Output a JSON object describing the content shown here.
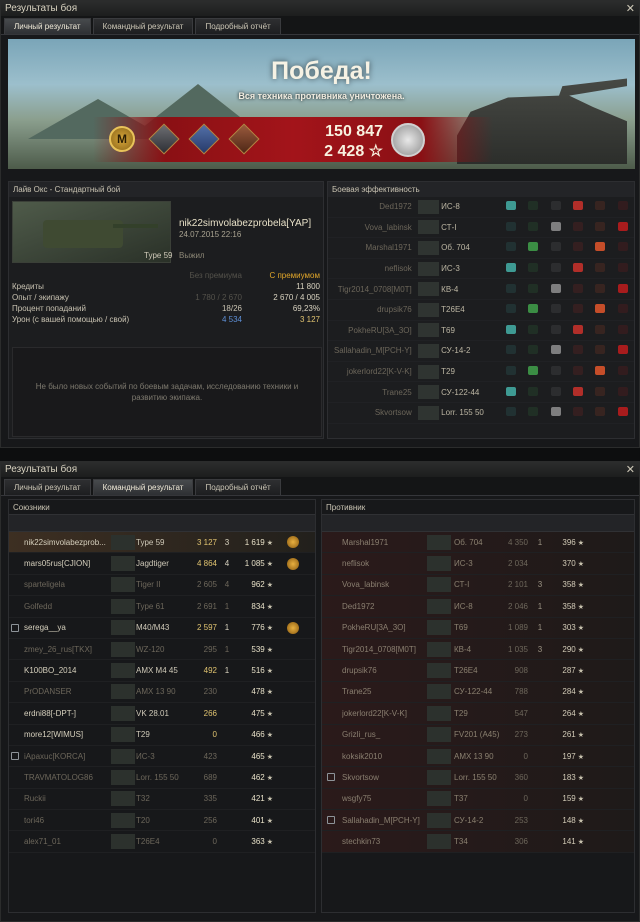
{
  "window_title": "Результаты боя",
  "close_glyph": "✕",
  "tabs": [
    "Личный результат",
    "Командный результат",
    "Подробный отчёт"
  ],
  "banner": {
    "title": "Победа!",
    "subtitle": "Вся техника противника уничтожена.",
    "credits": "150 847",
    "xp": "2 428 ☆",
    "mastery_badge": "М"
  },
  "personal": {
    "battle_type": "Лайв Окс - Стандартный бой",
    "player_name": "nik22simvolabezprobela[YAP]",
    "date": "24.07.2015 22:16",
    "tank": "Type 59",
    "status": "Выжил",
    "col_without": "Без премиума",
    "col_with": "С премиумом",
    "rows": [
      {
        "label": "Кредиты",
        "without": "",
        "with": "11 800"
      },
      {
        "label": "Опыт / экипажу",
        "without": "1 780 / 2 670",
        "with": "2 670 / 4 005"
      },
      {
        "label": "Процент попаданий",
        "without": "18/26",
        "with": "69,23%"
      },
      {
        "label": "Урон (с вашей помощью / свой)",
        "without": "4 534",
        "with": "3 127"
      }
    ],
    "no_events": "Не было новых событий по боевым задачам, исследованию техники и развитию экипажа."
  },
  "efficiency": {
    "header": "Боевая эффективность",
    "rows": [
      {
        "player": "Ded1972",
        "tank": "ИС-8"
      },
      {
        "player": "Vova_labinsk",
        "tank": "СТ-I"
      },
      {
        "player": "Marshal1971",
        "tank": "Об. 704"
      },
      {
        "player": "neflisok",
        "tank": "ИС-3"
      },
      {
        "player": "Tigr2014_0708[M0T]",
        "tank": "КВ-4"
      },
      {
        "player": "drupsik76",
        "tank": "T26E4"
      },
      {
        "player": "PokheRU[3A_3O]",
        "tank": "T69"
      },
      {
        "player": "Sallahadin_M[PCH-Y]",
        "tank": "СУ-14-2"
      },
      {
        "player": "jokerlord22[K-V-K]",
        "tank": "T29"
      },
      {
        "player": "Trane25",
        "tank": "СУ-122-44"
      },
      {
        "player": "Skvortsow",
        "tank": "Lorr. 155 50"
      }
    ]
  },
  "team": {
    "allies_label": "Союзники",
    "enemies_label": "Противник",
    "allies": [
      {
        "name": "nik22simvolabezprob...",
        "tank": "Type 59",
        "dmg": "3 127",
        "kills": "3",
        "xp": "1 619",
        "medal": true,
        "dead": false,
        "hl": true
      },
      {
        "name": "mars05rus[CJION]",
        "tank": "Jagdtiger",
        "dmg": "4 864",
        "kills": "4",
        "xp": "1 085",
        "medal": true,
        "dead": false
      },
      {
        "name": "sparteligela",
        "tank": "Tiger II",
        "dmg": "2 605",
        "kills": "4",
        "xp": "962",
        "dead": true
      },
      {
        "name": "Golfedd",
        "tank": "Type 61",
        "dmg": "2 691",
        "kills": "1",
        "xp": "834",
        "dead": true
      },
      {
        "name": "serega__ya",
        "tank": "M40/M43",
        "dmg": "2 597",
        "kills": "1",
        "xp": "776",
        "medal": true,
        "dead": false,
        "platoon": true
      },
      {
        "name": "zmey_26_rus[TKX]",
        "tank": "WZ-120",
        "dmg": "295",
        "kills": "1",
        "xp": "539",
        "dead": true
      },
      {
        "name": "K100BO_2014",
        "tank": "AMX M4 45",
        "dmg": "492",
        "kills": "1",
        "xp": "516",
        "dead": false
      },
      {
        "name": "PrODANSER",
        "tank": "AMX 13 90",
        "dmg": "230",
        "kills": "",
        "xp": "478",
        "dead": true
      },
      {
        "name": "erdni88[-DPT-]",
        "tank": "VK 28.01",
        "dmg": "266",
        "kills": "",
        "xp": "475",
        "dead": false
      },
      {
        "name": "more12[WIMUS]",
        "tank": "T29",
        "dmg": "0",
        "kills": "",
        "xp": "466",
        "dead": false
      },
      {
        "name": "iApaxuc[KORCA]",
        "tank": "ИС-3",
        "dmg": "423",
        "kills": "",
        "xp": "465",
        "dead": true,
        "platoon": true
      },
      {
        "name": "TRAVMATOLOG86",
        "tank": "Lorr. 155 50",
        "dmg": "689",
        "kills": "",
        "xp": "462",
        "dead": true
      },
      {
        "name": "Ruckii",
        "tank": "T32",
        "dmg": "335",
        "kills": "",
        "xp": "421",
        "dead": true
      },
      {
        "name": "tori46",
        "tank": "T20",
        "dmg": "256",
        "kills": "",
        "xp": "401",
        "dead": true
      },
      {
        "name": "alex71_01",
        "tank": "T26E4",
        "dmg": "0",
        "kills": "",
        "xp": "363",
        "dead": true
      }
    ],
    "enemies": [
      {
        "name": "Marshal1971",
        "tank": "Об. 704",
        "dmg": "4 350",
        "kills": "1",
        "xp": "396"
      },
      {
        "name": "neflisok",
        "tank": "ИС-3",
        "dmg": "2 034",
        "kills": "",
        "xp": "370"
      },
      {
        "name": "Vova_labinsk",
        "tank": "СТ-I",
        "dmg": "2 101",
        "kills": "3",
        "xp": "358"
      },
      {
        "name": "Ded1972",
        "tank": "ИС-8",
        "dmg": "2 046",
        "kills": "1",
        "xp": "358"
      },
      {
        "name": "PokheRU[3A_3O]",
        "tank": "T69",
        "dmg": "1 089",
        "kills": "1",
        "xp": "303"
      },
      {
        "name": "Tigr2014_0708[M0T]",
        "tank": "КВ-4",
        "dmg": "1 035",
        "kills": "3",
        "xp": "290"
      },
      {
        "name": "drupsik76",
        "tank": "T26E4",
        "dmg": "908",
        "kills": "",
        "xp": "287"
      },
      {
        "name": "Trane25",
        "tank": "СУ-122-44",
        "dmg": "788",
        "kills": "",
        "xp": "284"
      },
      {
        "name": "jokerlord22[K-V-K]",
        "tank": "T29",
        "dmg": "547",
        "kills": "",
        "xp": "264"
      },
      {
        "name": "Grizli_rus_",
        "tank": "FV201 (A45)",
        "dmg": "273",
        "kills": "",
        "xp": "261"
      },
      {
        "name": "koksik2010",
        "tank": "AMX 13 90",
        "dmg": "0",
        "kills": "",
        "xp": "197"
      },
      {
        "name": "Skvortsow",
        "tank": "Lorr. 155 50",
        "dmg": "360",
        "kills": "",
        "xp": "183",
        "platoon": true
      },
      {
        "name": "wsgfy75",
        "tank": "T37",
        "dmg": "0",
        "kills": "",
        "xp": "159"
      },
      {
        "name": "Sallahadin_M[PCH-Y]",
        "tank": "СУ-14-2",
        "dmg": "253",
        "kills": "",
        "xp": "148",
        "platoon": true
      },
      {
        "name": "stechkin73",
        "tank": "T34",
        "dmg": "306",
        "kills": "",
        "xp": "141"
      }
    ]
  },
  "colors": {
    "accent_red": "#a3141a",
    "gold": "#e0c370",
    "bg": "#17181a"
  }
}
